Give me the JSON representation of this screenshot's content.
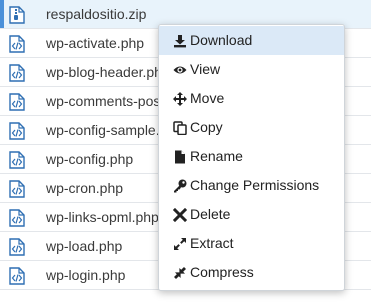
{
  "files": [
    {
      "name": "respaldositio.zip",
      "type": "zip",
      "selected": true
    },
    {
      "name": "wp-activate.php",
      "type": "php",
      "selected": false
    },
    {
      "name": "wp-blog-header.php",
      "type": "php",
      "selected": false
    },
    {
      "name": "wp-comments-post.php",
      "type": "php",
      "selected": false
    },
    {
      "name": "wp-config-sample.php",
      "type": "php",
      "selected": false
    },
    {
      "name": "wp-config.php",
      "type": "php",
      "selected": false
    },
    {
      "name": "wp-cron.php",
      "type": "php",
      "selected": false
    },
    {
      "name": "wp-links-opml.php",
      "type": "php",
      "selected": false
    },
    {
      "name": "wp-load.php",
      "type": "php",
      "selected": false
    },
    {
      "name": "wp-login.php",
      "type": "php",
      "selected": false
    }
  ],
  "context_menu": {
    "items": [
      {
        "label": "Download",
        "icon": "download-icon",
        "active": true
      },
      {
        "label": "View",
        "icon": "eye-icon",
        "active": false
      },
      {
        "label": "Move",
        "icon": "move-icon",
        "active": false
      },
      {
        "label": "Copy",
        "icon": "copy-icon",
        "active": false
      },
      {
        "label": "Rename",
        "icon": "file-icon",
        "active": false
      },
      {
        "label": "Change Permissions",
        "icon": "key-icon",
        "active": false
      },
      {
        "label": "Delete",
        "icon": "close-icon",
        "active": false
      },
      {
        "label": "Extract",
        "icon": "expand-icon",
        "active": false
      },
      {
        "label": "Compress",
        "icon": "compress-icon",
        "active": false
      }
    ]
  },
  "colors": {
    "selected_row": "#e8f3fb",
    "active_menu_item": "#dbe9f7",
    "icon_blue": "#2f6fb3"
  }
}
